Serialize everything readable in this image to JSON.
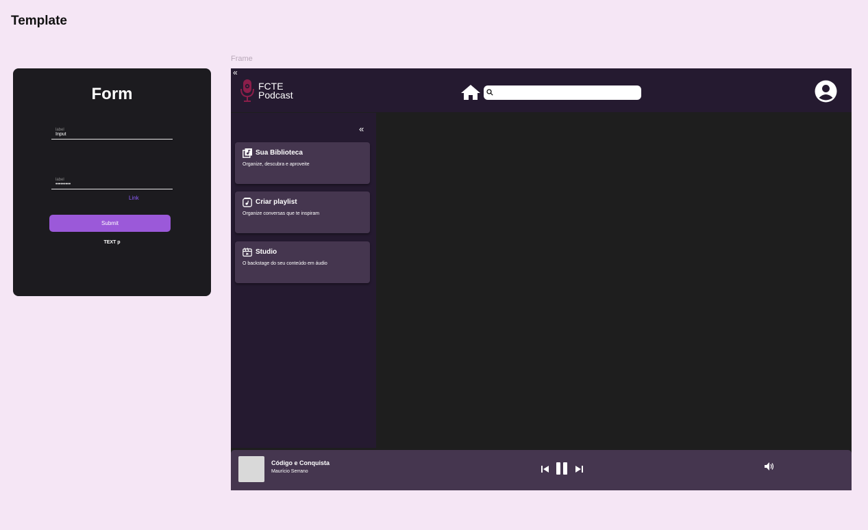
{
  "page": {
    "title": "Template",
    "frame_label": "Frame"
  },
  "form": {
    "title": "Form",
    "field1": {
      "label": "label",
      "value": "Input"
    },
    "field2": {
      "label": "label",
      "value": "•••••••••"
    },
    "link": "Link",
    "submit": "Submit",
    "text_p": "TEXT p"
  },
  "app": {
    "logo": {
      "line1": "FCTE",
      "line2": "Podcast"
    },
    "search": {
      "value": "",
      "placeholder": ""
    },
    "cards": [
      {
        "title": "Sua Biblioteca",
        "subtitle": "Organize, descubra e aproveite",
        "icon": "library-music-icon"
      },
      {
        "title": "Criar playlist",
        "subtitle": "Organize conversas que te inspiram",
        "icon": "playlist-create-icon"
      },
      {
        "title": "Studio",
        "subtitle": "O backstage do seu conteúdo em áudio",
        "icon": "studio-icon"
      }
    ],
    "player": {
      "title": "Código e Conquista",
      "artist": "Maurício Serrano"
    }
  },
  "colors": {
    "background": "#f5e6f5",
    "form_card": "#1c1b1f",
    "accent": "#9b59d9",
    "topbar": "#251a30",
    "card": "#45364f",
    "content": "#1e1e1e",
    "logo_mic": "#8b1e4a"
  }
}
